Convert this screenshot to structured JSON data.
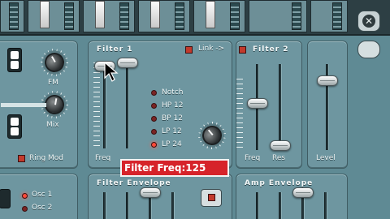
{
  "filter1": {
    "title": "Filter 1",
    "link_label": "Link ->",
    "freq_label": "Freq",
    "modes": [
      "Notch",
      "HP 12",
      "BP 12",
      "LP 12",
      "LP 24"
    ],
    "active_mode": "LP 24"
  },
  "filter2": {
    "title": "Filter 2",
    "freq_label": "Freq",
    "res_label": "Res"
  },
  "level": {
    "label": "Level"
  },
  "osc_controls": {
    "fm_label": "FM",
    "mix_label": "Mix",
    "ring_mod_label": "Ring Mod"
  },
  "osc_select": {
    "osc1_label": "Osc 1",
    "osc2_label": "Osc 2"
  },
  "filter_envelope": {
    "title": "Filter Envelope"
  },
  "amp_envelope": {
    "title": "Amp Envelope"
  },
  "tooltip": {
    "text": "Filter Freq:125"
  },
  "colors": {
    "panel": "#6e96a0",
    "led_on": "#ff4a3a",
    "tooltip_bg": "#d6232a"
  },
  "icons": {
    "close": "close-icon",
    "badge": "reason-logo-icon",
    "cursor": "mouse-pointer-icon"
  }
}
